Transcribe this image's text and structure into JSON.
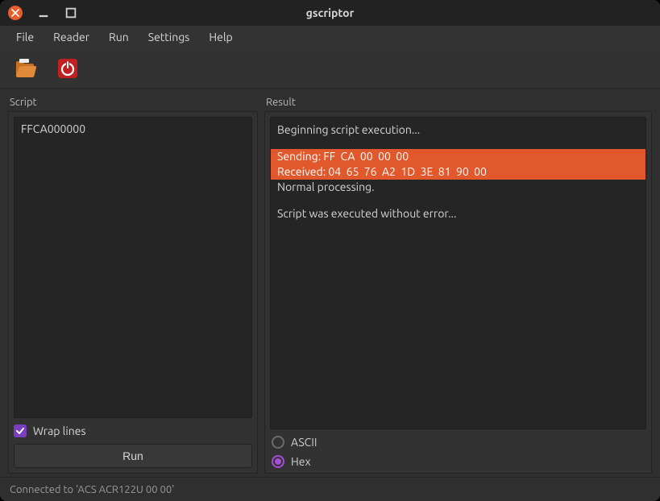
{
  "window": {
    "title": "gscriptor"
  },
  "menu": {
    "file": "File",
    "reader": "Reader",
    "run": "Run",
    "settings": "Settings",
    "help": "Help"
  },
  "toolbar": {
    "open_icon": "open-icon",
    "power_icon": "power-icon"
  },
  "panels": {
    "script_label": "Script",
    "result_label": "Result"
  },
  "script": {
    "value": "FFCA000000",
    "wrap_label": "Wrap lines",
    "wrap_checked": true,
    "run_label": "Run"
  },
  "result": {
    "lines": [
      {
        "text": "Beginning script execution...",
        "hl": false
      },
      {
        "gap": true
      },
      {
        "text": "Sending: FF  CA  00  00  00",
        "hl": true
      },
      {
        "text": "Received: 04  65  76  A2  1D  3E  81  90  00",
        "hl": true
      },
      {
        "text": "Normal processing.",
        "hl": false
      },
      {
        "gap": true
      },
      {
        "text": "Script was executed without error...",
        "hl": false
      }
    ],
    "ascii_label": "ASCII",
    "hex_label": "Hex",
    "selected": "hex"
  },
  "status": {
    "text": "Connected to 'ACS ACR122U 00 00'"
  }
}
